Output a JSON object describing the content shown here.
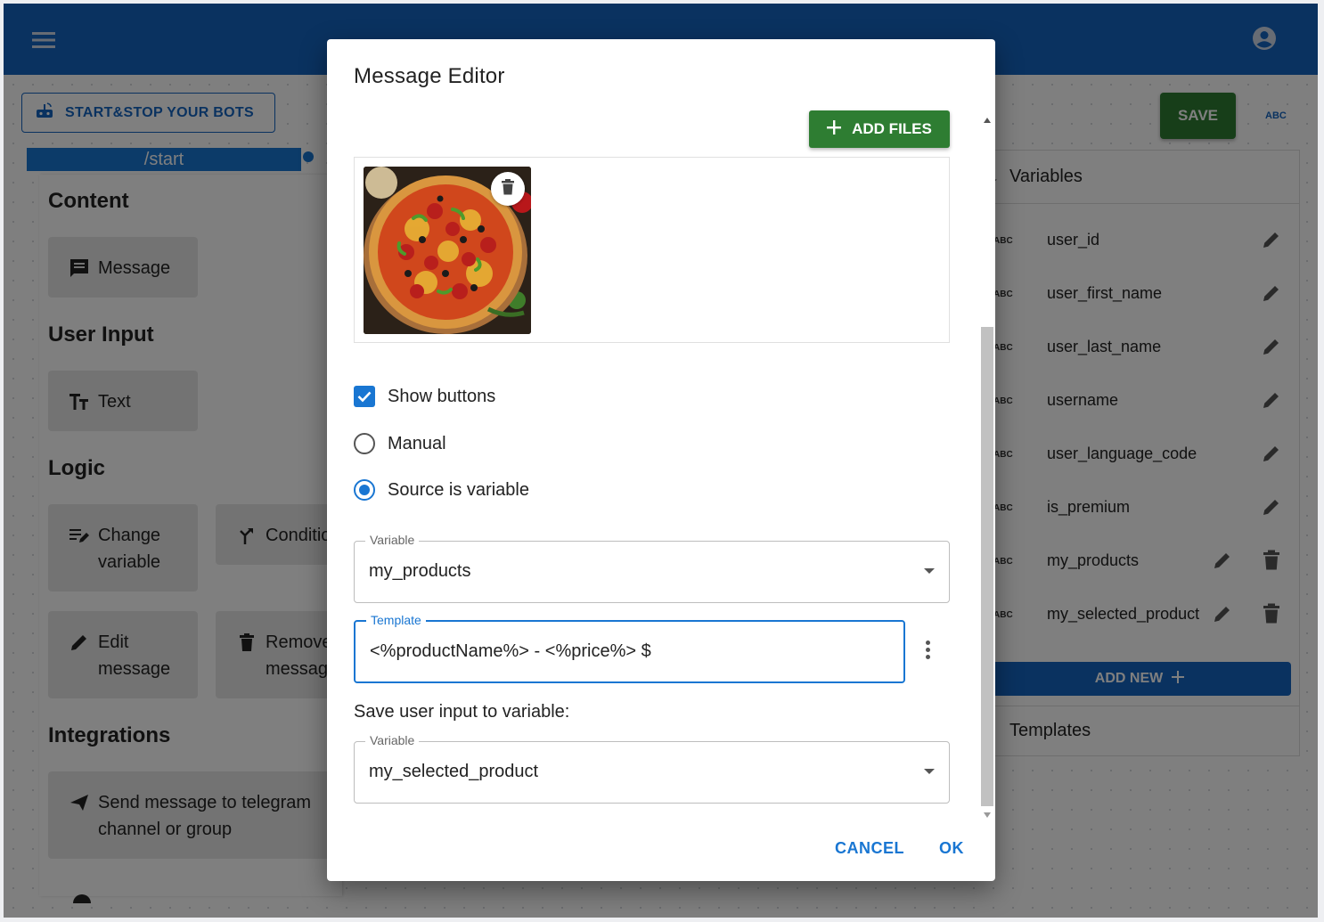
{
  "colors": {
    "primary": "#1565c0",
    "accent": "#1976d2",
    "success": "#2e7d32"
  },
  "appbar": {
    "menu_icon": "menu-icon",
    "account_icon": "account-circle-icon"
  },
  "toolbar": {
    "startstop_label": "START&STOP YOUR BOTS",
    "save_label": "SAVE",
    "abc_label": "ABC"
  },
  "canvas": {
    "start_node_label": "/start"
  },
  "palette": {
    "sections": {
      "content": "Content",
      "user_input": "User Input",
      "logic": "Logic",
      "integrations": "Integrations"
    },
    "items": {
      "message": "Message",
      "text": "Text",
      "change_variable": "Change variable",
      "condition": "Condition",
      "edit_message": "Edit message",
      "remove_message": "Remove message",
      "send_telegram": "Send message to telegram channel or group"
    }
  },
  "variables_panel": {
    "title": "Variables",
    "type_label": "ABC",
    "items": [
      {
        "name": "user_id"
      },
      {
        "name": "user_first_name"
      },
      {
        "name": "user_last_name"
      },
      {
        "name": "username"
      },
      {
        "name": "user_language_code"
      },
      {
        "name": "is_premium"
      },
      {
        "name": "my_products"
      },
      {
        "name": "my_selected_product"
      }
    ],
    "add_new_label": "ADD NEW",
    "templates_title": "Templates"
  },
  "dialog": {
    "title": "Message Editor",
    "add_files_label": "ADD FILES",
    "show_buttons_label": "Show buttons",
    "show_buttons_checked": true,
    "manual_label": "Manual",
    "source_variable_label": "Source is variable",
    "selected_source": "Source is variable",
    "variable_field": {
      "label": "Variable",
      "value": "my_products"
    },
    "template_field": {
      "label": "Template",
      "value": "<%productName%> - <%price%> $"
    },
    "save_input_label": "Save user input to variable:",
    "save_variable_field": {
      "label": "Variable",
      "value": "my_selected_product"
    },
    "cancel_label": "CANCEL",
    "ok_label": "OK"
  }
}
